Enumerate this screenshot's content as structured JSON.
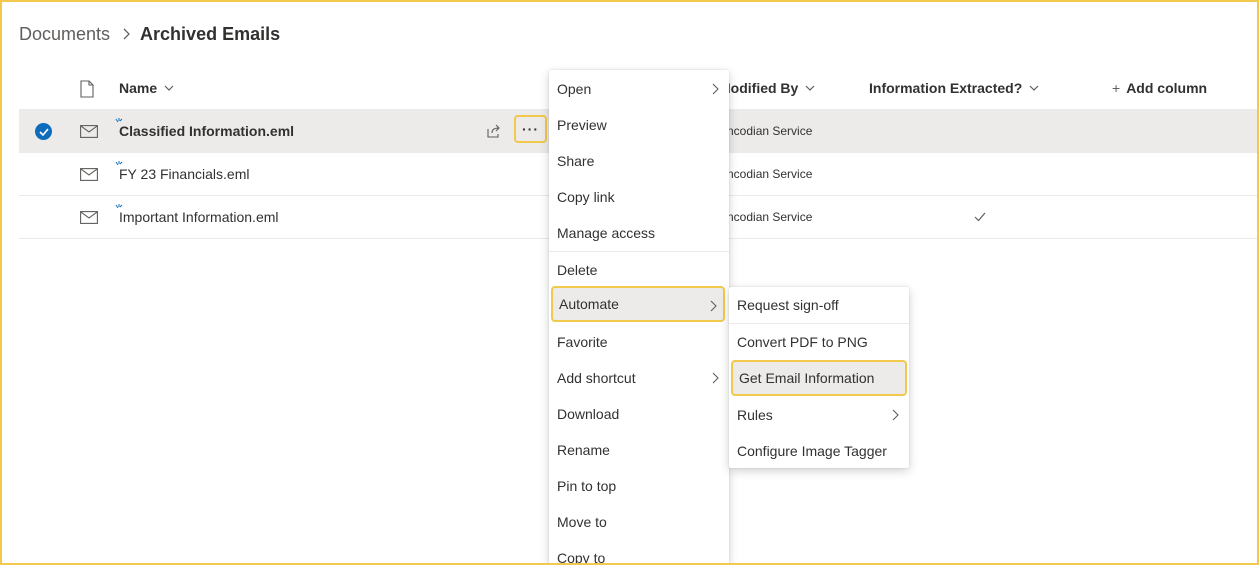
{
  "breadcrumb": {
    "root": "Documents",
    "current": "Archived Emails"
  },
  "columns": {
    "name": "Name",
    "modified_by": "Modified By",
    "information_extracted": "Information Extracted?",
    "add_column": "Add column"
  },
  "rows": [
    {
      "name": "Classified Information.eml",
      "modified_by": "Encodian Service",
      "information_extracted": false,
      "selected": true
    },
    {
      "name": "FY 23 Financials.eml",
      "modified_by": "Encodian Service",
      "information_extracted": false,
      "selected": false
    },
    {
      "name": "Important Information.eml",
      "modified_by": "Encodian Service",
      "information_extracted": true,
      "selected": false
    }
  ],
  "row_actions": {
    "more_label": "···"
  },
  "context_menu": {
    "items": [
      {
        "label": "Open",
        "has_submenu": true
      },
      {
        "label": "Preview",
        "has_submenu": false
      },
      {
        "label": "Share",
        "has_submenu": false
      },
      {
        "label": "Copy link",
        "has_submenu": false
      },
      {
        "label": "Manage access",
        "has_submenu": false
      },
      {
        "label": "Delete",
        "has_submenu": false
      },
      {
        "label": "Automate",
        "has_submenu": true,
        "active": true
      },
      {
        "label": "Favorite",
        "has_submenu": false
      },
      {
        "label": "Add shortcut",
        "has_submenu": true
      },
      {
        "label": "Download",
        "has_submenu": false
      },
      {
        "label": "Rename",
        "has_submenu": false
      },
      {
        "label": "Pin to top",
        "has_submenu": false
      },
      {
        "label": "Move to",
        "has_submenu": false
      },
      {
        "label": "Copy to",
        "has_submenu": false
      }
    ]
  },
  "automate_submenu": {
    "items": [
      {
        "label": "Request sign-off",
        "has_submenu": false
      },
      {
        "label": "Convert PDF to PNG",
        "has_submenu": false
      },
      {
        "label": "Get Email Information",
        "has_submenu": false,
        "highlighted": true
      },
      {
        "label": "Rules",
        "has_submenu": true
      },
      {
        "label": "Configure Image Tagger",
        "has_submenu": false
      }
    ]
  },
  "colors": {
    "highlight_border": "#f2c94c",
    "selected_row_bg": "#edebe9",
    "accent_blue": "#0f6cbd"
  }
}
